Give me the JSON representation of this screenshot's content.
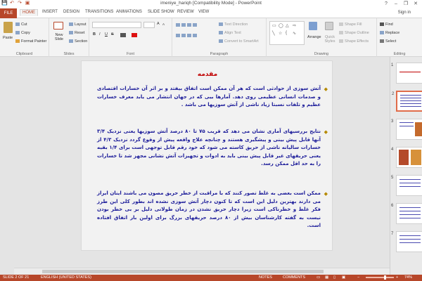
{
  "window": {
    "title": "imeniye_hariqh [Compatibility Mode] - PowerPoint",
    "signin": "Sign in",
    "minimize": "–",
    "restore": "❐",
    "close": "✕",
    "help": "?"
  },
  "qat": [
    "💾",
    "↶",
    "↷",
    "▣"
  ],
  "tabs": [
    {
      "label": "FILE"
    },
    {
      "label": "HOME"
    },
    {
      "label": "INSERT"
    },
    {
      "label": "DESIGN"
    },
    {
      "label": "TRANSITIONS"
    },
    {
      "label": "ANIMATIONS"
    },
    {
      "label": "SLIDE SHOW"
    },
    {
      "label": "REVIEW"
    },
    {
      "label": "VIEW"
    }
  ],
  "ribbon": {
    "clipboard": {
      "label": "Clipboard",
      "paste": "Paste",
      "cut": "Cut",
      "copy": "Copy",
      "format_painter": "Format Painter"
    },
    "slides": {
      "label": "Slides",
      "new_slide": "New Slide",
      "layout": "Layout",
      "reset": "Reset",
      "section": "Section"
    },
    "font": {
      "label": "Font",
      "bold": "B",
      "italic": "I",
      "underline": "U",
      "strike": "S",
      "size_up": "A",
      "size_down": "A"
    },
    "paragraph": {
      "label": "Paragraph",
      "text_direction": "Text Direction",
      "align_text": "Align Text",
      "smartart": "Convert to SmartArt"
    },
    "drawing": {
      "label": "Drawing",
      "arrange": "Arrange",
      "quick_styles": "Quick Styles",
      "shape_fill": "Shape Fill",
      "shape_outline": "Shape Outline",
      "shape_effects": "Shape Effects"
    },
    "editing": {
      "label": "Editing",
      "find": "Find",
      "replace": "Replace",
      "select": "Select"
    }
  },
  "slide": {
    "title": "مقدمه",
    "paragraphs": [
      "آتش سوزی از حوادثی است که هر آن ممکن است اتفاق بیفتد و بر اثر آن خسارات اقتصادی و صدمات انسانی عظیمی روی دهد. آمارها بیی که در جهان انتشار می یابد معرف خسارات عظیم و تلفات نسبتا زیاد ناشی از آتش سوزیها می باشد .",
      "نتایج بررسیهای آماری نشان می دهد که قریب ۷۵ تا ۸۰ درصد آتش سوزیها یعنی نزدیک ۳/۴ آنها قابل پیش بینی و پیشگیری هستند و چنانچه علاج واقعه پیش از وقوع گردد نزدیک ۴/۳ از خسارات سالیانه ناشی از حریق کاسته می شود که خود رقم قابل توجهی است برای ۱/۴ بقیه یعنی حریقهای غیر قابل پیش بینی باید به ادوات و تجهیزات آتش نشانی مجهز شد تا خسارات را به حد اقل ممکن رسد.",
      "ممکن است بعضی به غلط تصور کنند که با مراقبت از خطر حریق مصون می باشند اینان ایراز می دارند بهترین دلیل این است که تا کنون دچار آتش سوزی نشده اند بطور کلی این طرز فکر غلط و خطرناکی است زیرا دچار حریق نشدن در زمان طولانی دلیل بر بی خطر بودن نیست به گفته کارشناسان بیش از ۸۰ درصد حریقهای بزرگ برای اولین بار اتفاق افتاده است."
    ]
  },
  "thumbnails": [
    {
      "num": "1"
    },
    {
      "num": "2"
    },
    {
      "num": "3"
    },
    {
      "num": "4"
    },
    {
      "num": "5"
    },
    {
      "num": "6"
    },
    {
      "num": "7"
    }
  ],
  "status": {
    "slide_info": "SLIDE 2 OF 21",
    "language": "ENGLISH (UNITED STATES)",
    "notes": "NOTES",
    "comments": "COMMENTS",
    "zoom": "74%",
    "zoom_value_percent": 74
  }
}
